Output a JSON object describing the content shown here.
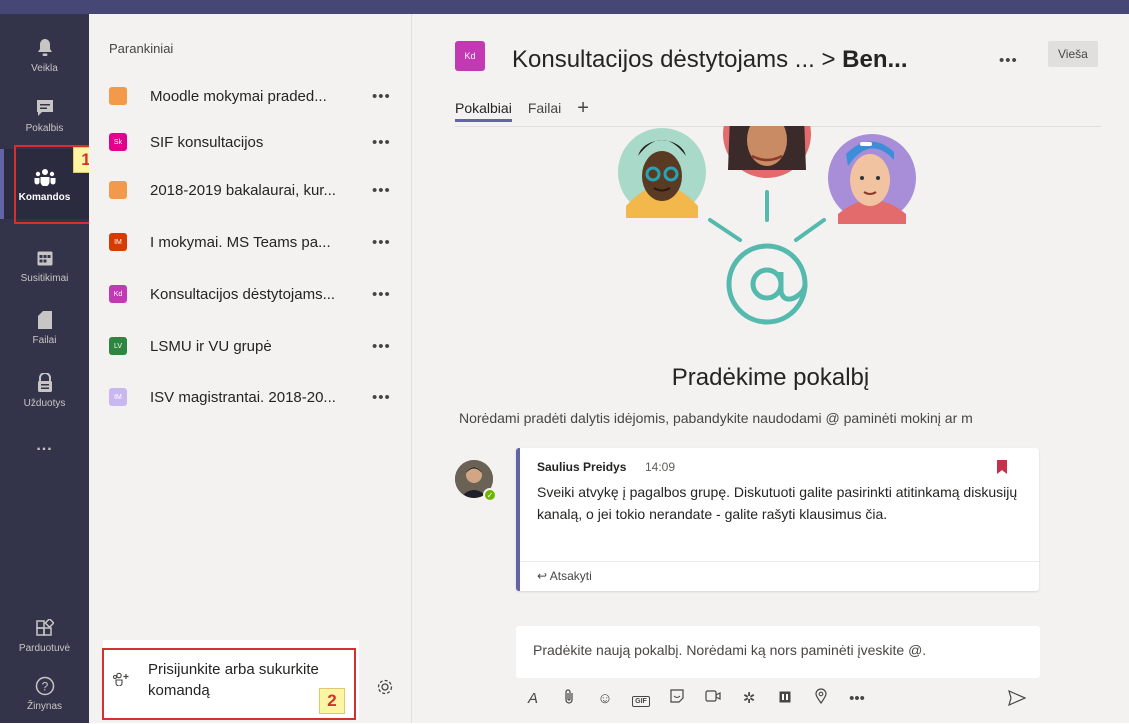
{
  "colors": {
    "topbar": "#464775",
    "rail": "#33344a",
    "accent": "#6264a7",
    "callout": "#d3302f",
    "callout_fill": "#fdf5a4"
  },
  "rail": {
    "items": [
      {
        "label": "Veikla",
        "icon": "bell-icon"
      },
      {
        "label": "Pokalbis",
        "icon": "chat-icon"
      },
      {
        "label": "Komandos",
        "icon": "teams-icon"
      },
      {
        "label": "Susitikimai",
        "icon": "calendar-icon"
      },
      {
        "label": "Failai",
        "icon": "file-icon"
      },
      {
        "label": "Užduotys",
        "icon": "assignments-icon"
      },
      {
        "label": "...",
        "icon": "more-icon"
      }
    ],
    "store_label": "Parduotuvė",
    "help_label": "Žinynas"
  },
  "callouts": {
    "one": "1",
    "two": "2"
  },
  "teams_pane": {
    "section_title": "Parankiniai",
    "teams": [
      {
        "name": "Moodle mokymai praded...",
        "initials": "",
        "color": "#f2994a"
      },
      {
        "name": "SIF konsultacijos",
        "initials": "Sk",
        "color": "#e3008c"
      },
      {
        "name": "2018-2019 bakalaurai, kur...",
        "initials": "",
        "color": "#f2994a"
      },
      {
        "name": "I mokymai. MS Teams pa...",
        "initials": "IM",
        "color": "#d83b01"
      },
      {
        "name": "Konsultacijos dėstytojams...",
        "initials": "Kd",
        "color": "#c239b3"
      },
      {
        "name": "LSMU ir VU grupė",
        "initials": "LV",
        "color": "#2e8540"
      },
      {
        "name": "ISV magistrantai. 2018-20...",
        "initials": "IM",
        "color": "#c9b8f0"
      }
    ],
    "more": "•••",
    "join_label": "Prisijunkite arba sukurkite komandą"
  },
  "header": {
    "avatar_initials": "Kd",
    "title_team": "Konsultacijos dėstytojams ... ",
    "separator": "> ",
    "title_channel": "Ben...",
    "more": "•••",
    "badge": "Vieša",
    "tabs": [
      "Pokalbiai",
      "Failai"
    ],
    "add_tab": "+"
  },
  "empty_state": {
    "title": "Pradėkime pokalbį",
    "subtitle": "Norėdami pradėti dalytis idėjomis, pabandykite naudodami @ paminėti mokinį ar m"
  },
  "message": {
    "author": "Saulius Preidys",
    "time": "14:09",
    "body": "Sveiki atvykę į pagalbos grupę. Diskutuoti galite pasirinkti atitinkamą diskusijų kanalą, o jei tokio nerandate - galite rašyti klausimus čia.",
    "reply": "Atsakyti"
  },
  "compose": {
    "placeholder": "Pradėkite naują pokalbį. Norėdami ką nors paminėti įveskite @.",
    "gif_label": "GIF",
    "more": "•••"
  }
}
